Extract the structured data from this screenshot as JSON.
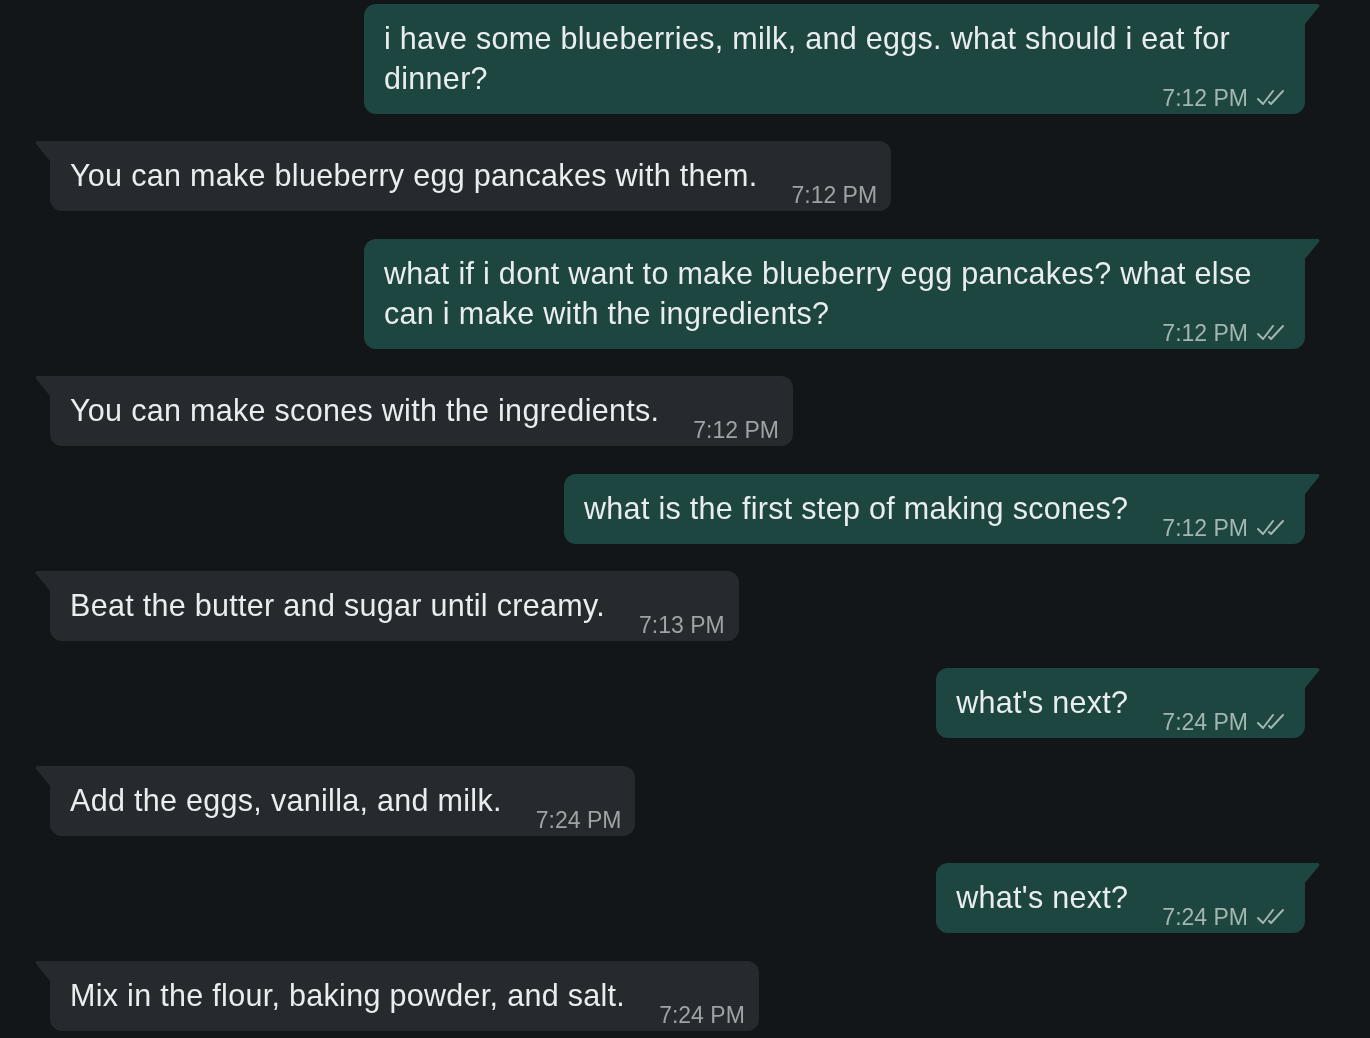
{
  "messages": [
    {
      "kind": "outgoing",
      "text": "i have some blueberries, milk, and eggs. what should i eat for dinner?",
      "time": "7:12 PM",
      "read": false
    },
    {
      "kind": "incoming",
      "text": "You can make blueberry egg pancakes with them.",
      "time": "7:12 PM"
    },
    {
      "kind": "outgoing",
      "text": "what if i dont want to make blueberry egg pancakes? what else can i make with the ingredients?",
      "time": "7:12 PM",
      "read": false
    },
    {
      "kind": "incoming",
      "text": "You can make scones with the ingredients.",
      "time": "7:12 PM"
    },
    {
      "kind": "outgoing",
      "text": "what is the first step of making scones?",
      "time": "7:12 PM",
      "read": false
    },
    {
      "kind": "incoming",
      "text": "Beat the butter and sugar until creamy.",
      "time": "7:13 PM"
    },
    {
      "kind": "outgoing",
      "text": "what's next?",
      "time": "7:24 PM",
      "read": false
    },
    {
      "kind": "incoming",
      "text": "Add the eggs, vanilla, and milk.",
      "time": "7:24 PM"
    },
    {
      "kind": "outgoing",
      "text": "what's next?",
      "time": "7:24 PM",
      "read": false
    },
    {
      "kind": "incoming",
      "text": "Mix in the flour, baking powder, and salt.",
      "time": "7:24 PM"
    }
  ]
}
